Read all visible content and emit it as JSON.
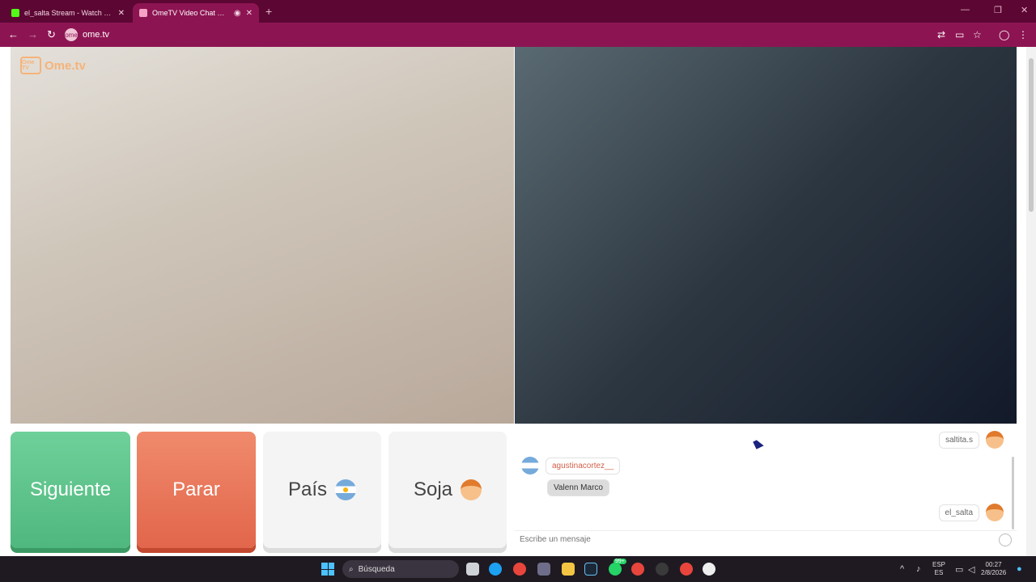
{
  "browser": {
    "tabs": [
      {
        "title": "el_salta Stream - Watch Live on",
        "favicon_color": "#53fc18",
        "state": "inactive"
      },
      {
        "title": "OmeTV Video Chat — Alte",
        "favicon_color": "#f5a3c4",
        "state": "active"
      }
    ],
    "url": "ome.tv",
    "site_icon": "ome"
  },
  "page": {
    "brand": {
      "name": "Ome.tv",
      "badge": "Ome TV"
    },
    "buttons": {
      "next": "Siguiente",
      "stop": "Parar",
      "country": "País",
      "gender": "Soja"
    },
    "chat": {
      "messages": [
        {
          "user": "saltita.s",
          "side": "right"
        },
        {
          "user": "agustinacortez__",
          "side": "left"
        },
        {
          "user": "Valenn Marco",
          "side": "left"
        },
        {
          "user": "el_salta",
          "side": "right"
        }
      ],
      "input_placeholder": "Escribe un mensaje"
    }
  },
  "taskbar": {
    "search_label": "Búsqueda",
    "language": "ESP",
    "language_sub": "ES",
    "time": "00:27",
    "date": "2/8/2026",
    "badge_count": "99+"
  }
}
